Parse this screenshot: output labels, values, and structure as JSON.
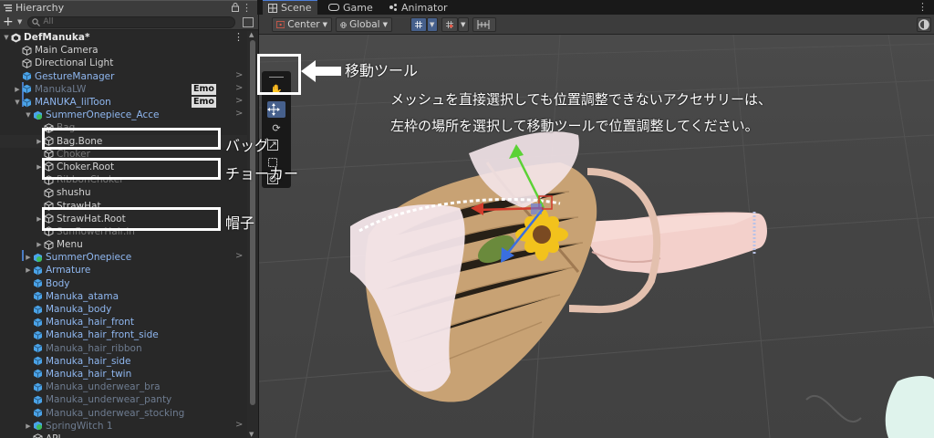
{
  "hierarchy": {
    "tab_title": "Hierarchy",
    "search_placeholder": "All",
    "add_label": "+",
    "rows": [
      {
        "label": "DefManuka*",
        "indent": 0,
        "arrow": "▼",
        "icon": "unity-icon",
        "style": "white",
        "bold": true,
        "kebab": "⋮"
      },
      {
        "label": "Main Camera",
        "indent": 1,
        "arrow": "",
        "icon": "cube-icon",
        "style": ""
      },
      {
        "label": "Directional Light",
        "indent": 1,
        "arrow": "",
        "icon": "cube-icon",
        "style": ""
      },
      {
        "label": "GestureManager",
        "indent": 1,
        "arrow": "",
        "icon": "prefab-icon",
        "style": "blue",
        "rarrow": ">"
      },
      {
        "label": "ManukaLW",
        "indent": 1,
        "arrow": "▶",
        "icon": "prefab-icon",
        "style": "dim",
        "badge": "Emo",
        "rarrow": ">"
      },
      {
        "label": "MANUKA_lilToon",
        "indent": 1,
        "arrow": "▼",
        "icon": "prefab-icon",
        "style": "blue",
        "badge": "Emo",
        "rarrow": ">"
      },
      {
        "label": "SummerOnepiece_Acce",
        "indent": 2,
        "arrow": "▼",
        "icon": "prefab-icon-green",
        "style": "blue",
        "rarrow": ">"
      },
      {
        "label": "Bag",
        "indent": 3,
        "arrow": "",
        "icon": "cube-icon",
        "style": "strike"
      },
      {
        "label": "Bag.Bone",
        "indent": 3,
        "arrow": "▶",
        "icon": "cube-icon",
        "style": "",
        "selected": true
      },
      {
        "label": "Choker",
        "indent": 3,
        "arrow": "",
        "icon": "cube-icon",
        "style": "strike"
      },
      {
        "label": "Choker.Root",
        "indent": 3,
        "arrow": "▶",
        "icon": "cube-icon",
        "style": ""
      },
      {
        "label": "RibbonChoker",
        "indent": 3,
        "arrow": "",
        "icon": "cube-icon",
        "style": "strike"
      },
      {
        "label": "shushu",
        "indent": 3,
        "arrow": "",
        "icon": "cube-icon",
        "style": ""
      },
      {
        "label": "StrawHat",
        "indent": 3,
        "arrow": "",
        "icon": "cube-icon",
        "style": ""
      },
      {
        "label": "StrawHat.Root",
        "indent": 3,
        "arrow": "▶",
        "icon": "cube-icon",
        "style": ""
      },
      {
        "label": "SunflowerHair.in",
        "indent": 3,
        "arrow": "",
        "icon": "cube-icon",
        "style": "strike"
      },
      {
        "label": "Menu",
        "indent": 3,
        "arrow": "▶",
        "icon": "cube-icon",
        "style": ""
      },
      {
        "label": "SummerOnepiece",
        "indent": 2,
        "arrow": "▶",
        "icon": "prefab-icon-green",
        "style": "blue",
        "rarrow": ">"
      },
      {
        "label": "Armature",
        "indent": 2,
        "arrow": "▶",
        "icon": "prefab-icon",
        "style": "blue"
      },
      {
        "label": "Body",
        "indent": 2,
        "arrow": "",
        "icon": "prefab-icon",
        "style": "blue"
      },
      {
        "label": "Manuka_atama",
        "indent": 2,
        "arrow": "",
        "icon": "prefab-icon",
        "style": "blue"
      },
      {
        "label": "Manuka_body",
        "indent": 2,
        "arrow": "",
        "icon": "prefab-icon",
        "style": "blue"
      },
      {
        "label": "Manuka_hair_front",
        "indent": 2,
        "arrow": "",
        "icon": "prefab-icon",
        "style": "blue"
      },
      {
        "label": "Manuka_hair_front_side",
        "indent": 2,
        "arrow": "",
        "icon": "prefab-icon",
        "style": "blue"
      },
      {
        "label": "Manuka_hair_ribbon",
        "indent": 2,
        "arrow": "",
        "icon": "prefab-icon",
        "style": "dim"
      },
      {
        "label": "Manuka_hair_side",
        "indent": 2,
        "arrow": "",
        "icon": "prefab-icon",
        "style": "blue"
      },
      {
        "label": "Manuka_hair_twin",
        "indent": 2,
        "arrow": "",
        "icon": "prefab-icon",
        "style": "blue"
      },
      {
        "label": "Manuka_underwear_bra",
        "indent": 2,
        "arrow": "",
        "icon": "prefab-icon",
        "style": "dim"
      },
      {
        "label": "Manuka_underwear_panty",
        "indent": 2,
        "arrow": "",
        "icon": "prefab-icon",
        "style": "dim"
      },
      {
        "label": "Manuka_underwear_stocking",
        "indent": 2,
        "arrow": "",
        "icon": "prefab-icon",
        "style": "dim"
      },
      {
        "label": "SpringWitch 1",
        "indent": 2,
        "arrow": "▶",
        "icon": "prefab-icon-green",
        "style": "dim",
        "rarrow": ">"
      },
      {
        "label": "API",
        "indent": 2,
        "arrow": "",
        "icon": "cube-icon",
        "style": ""
      }
    ]
  },
  "scene": {
    "tabs": [
      {
        "label": "Scene",
        "icon": "grid-icon",
        "active": true
      },
      {
        "label": "Game",
        "icon": "gamepad-icon",
        "active": false
      },
      {
        "label": "Animator",
        "icon": "animator-icon",
        "active": false
      }
    ],
    "toolbar": {
      "pivot": "Center",
      "space": "Global"
    }
  },
  "annotations": {
    "move_tool": "移動ツール",
    "line1": "メッシュを直接選択しても位置調整できないアクセサリーは、",
    "line2": "左枠の場所を選択して移動ツールで位置調整してください。",
    "bag": "バッグ",
    "choker": "チョーカー",
    "hat": "帽子"
  },
  "colors": {
    "accent": "#4c7dd6",
    "prefab_text": "#8fb7f0",
    "panel": "#282828",
    "scene_bg": "#464646"
  }
}
